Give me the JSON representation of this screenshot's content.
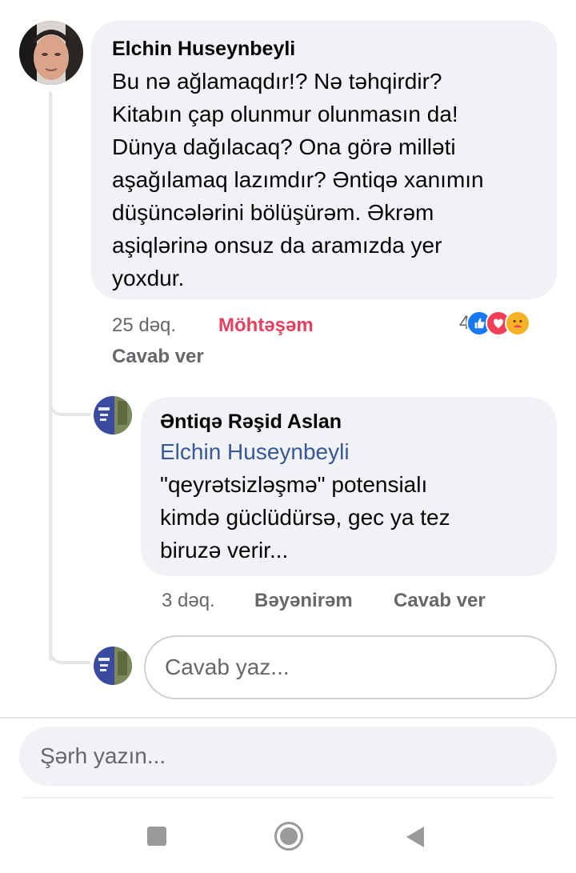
{
  "comment": {
    "author": "Elchin  Huseynbeyli",
    "text": "Bu nə ağlamaqdır!? Nə təhqirdir?\nKitabın çap olunmur olunmasın da!\nDünya dağılacaq? Ona görə milləti\naşağılamaq lazımdır? Əntiqə xanımın\ndüşüncələrini bölüşürəm. Əkrəm\naşiqlərinə onsuz da aramızda yer\nyoxdur.",
    "time": "25 dəq.",
    "reaction_label": "Möhtəşəm",
    "reply_label": "Cavab ver",
    "reaction_count": "4",
    "reaction_icons": [
      "like-icon",
      "love-icon",
      "care-icon"
    ],
    "reaction_colors": {
      "like": "#1877f2",
      "love": "#f33e58",
      "care": "#f7b125",
      "label": "#e4405f"
    }
  },
  "reply": {
    "author": "Əntiqə Rəşid Aslan",
    "mention": "Elchin  Huseynbeyli",
    "text": "\"qeyrətsizləşmə\" potensialı\nkimdə güclüdürsə, gec ya tez\nbiruzə verir...",
    "time": "3 dəq.",
    "like_label": "Bəyənirəm",
    "reply_label": "Cavab ver"
  },
  "reply_input": {
    "placeholder": "Cavab yaz..."
  },
  "comment_input": {
    "placeholder": "Şərh yazın..."
  },
  "colors": {
    "bubble": "#f0f2f5",
    "mention": "#385898",
    "meta": "#65676b"
  }
}
